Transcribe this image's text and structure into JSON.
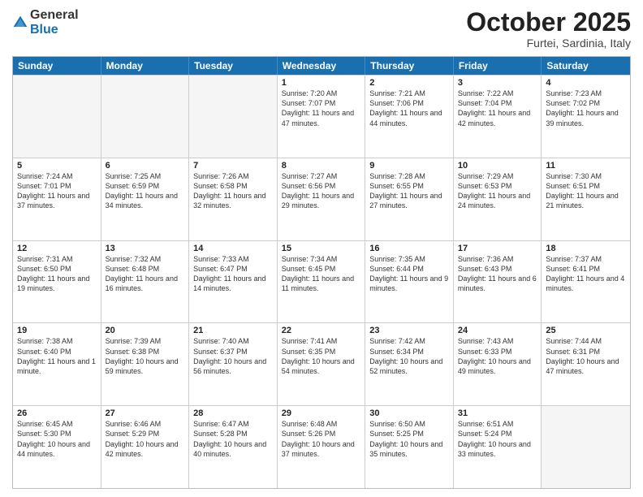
{
  "header": {
    "logo_general": "General",
    "logo_blue": "Blue",
    "month": "October 2025",
    "location": "Furtei, Sardinia, Italy"
  },
  "days_of_week": [
    "Sunday",
    "Monday",
    "Tuesday",
    "Wednesday",
    "Thursday",
    "Friday",
    "Saturday"
  ],
  "rows": [
    [
      {
        "day": "",
        "info": "",
        "empty": true
      },
      {
        "day": "",
        "info": "",
        "empty": true
      },
      {
        "day": "",
        "info": "",
        "empty": true
      },
      {
        "day": "1",
        "info": "Sunrise: 7:20 AM\nSunset: 7:07 PM\nDaylight: 11 hours and 47 minutes."
      },
      {
        "day": "2",
        "info": "Sunrise: 7:21 AM\nSunset: 7:06 PM\nDaylight: 11 hours and 44 minutes."
      },
      {
        "day": "3",
        "info": "Sunrise: 7:22 AM\nSunset: 7:04 PM\nDaylight: 11 hours and 42 minutes."
      },
      {
        "day": "4",
        "info": "Sunrise: 7:23 AM\nSunset: 7:02 PM\nDaylight: 11 hours and 39 minutes."
      }
    ],
    [
      {
        "day": "5",
        "info": "Sunrise: 7:24 AM\nSunset: 7:01 PM\nDaylight: 11 hours and 37 minutes."
      },
      {
        "day": "6",
        "info": "Sunrise: 7:25 AM\nSunset: 6:59 PM\nDaylight: 11 hours and 34 minutes."
      },
      {
        "day": "7",
        "info": "Sunrise: 7:26 AM\nSunset: 6:58 PM\nDaylight: 11 hours and 32 minutes."
      },
      {
        "day": "8",
        "info": "Sunrise: 7:27 AM\nSunset: 6:56 PM\nDaylight: 11 hours and 29 minutes."
      },
      {
        "day": "9",
        "info": "Sunrise: 7:28 AM\nSunset: 6:55 PM\nDaylight: 11 hours and 27 minutes."
      },
      {
        "day": "10",
        "info": "Sunrise: 7:29 AM\nSunset: 6:53 PM\nDaylight: 11 hours and 24 minutes."
      },
      {
        "day": "11",
        "info": "Sunrise: 7:30 AM\nSunset: 6:51 PM\nDaylight: 11 hours and 21 minutes."
      }
    ],
    [
      {
        "day": "12",
        "info": "Sunrise: 7:31 AM\nSunset: 6:50 PM\nDaylight: 11 hours and 19 minutes."
      },
      {
        "day": "13",
        "info": "Sunrise: 7:32 AM\nSunset: 6:48 PM\nDaylight: 11 hours and 16 minutes."
      },
      {
        "day": "14",
        "info": "Sunrise: 7:33 AM\nSunset: 6:47 PM\nDaylight: 11 hours and 14 minutes."
      },
      {
        "day": "15",
        "info": "Sunrise: 7:34 AM\nSunset: 6:45 PM\nDaylight: 11 hours and 11 minutes."
      },
      {
        "day": "16",
        "info": "Sunrise: 7:35 AM\nSunset: 6:44 PM\nDaylight: 11 hours and 9 minutes."
      },
      {
        "day": "17",
        "info": "Sunrise: 7:36 AM\nSunset: 6:43 PM\nDaylight: 11 hours and 6 minutes."
      },
      {
        "day": "18",
        "info": "Sunrise: 7:37 AM\nSunset: 6:41 PM\nDaylight: 11 hours and 4 minutes."
      }
    ],
    [
      {
        "day": "19",
        "info": "Sunrise: 7:38 AM\nSunset: 6:40 PM\nDaylight: 11 hours and 1 minute."
      },
      {
        "day": "20",
        "info": "Sunrise: 7:39 AM\nSunset: 6:38 PM\nDaylight: 10 hours and 59 minutes."
      },
      {
        "day": "21",
        "info": "Sunrise: 7:40 AM\nSunset: 6:37 PM\nDaylight: 10 hours and 56 minutes."
      },
      {
        "day": "22",
        "info": "Sunrise: 7:41 AM\nSunset: 6:35 PM\nDaylight: 10 hours and 54 minutes."
      },
      {
        "day": "23",
        "info": "Sunrise: 7:42 AM\nSunset: 6:34 PM\nDaylight: 10 hours and 52 minutes."
      },
      {
        "day": "24",
        "info": "Sunrise: 7:43 AM\nSunset: 6:33 PM\nDaylight: 10 hours and 49 minutes."
      },
      {
        "day": "25",
        "info": "Sunrise: 7:44 AM\nSunset: 6:31 PM\nDaylight: 10 hours and 47 minutes."
      }
    ],
    [
      {
        "day": "26",
        "info": "Sunrise: 6:45 AM\nSunset: 5:30 PM\nDaylight: 10 hours and 44 minutes."
      },
      {
        "day": "27",
        "info": "Sunrise: 6:46 AM\nSunset: 5:29 PM\nDaylight: 10 hours and 42 minutes."
      },
      {
        "day": "28",
        "info": "Sunrise: 6:47 AM\nSunset: 5:28 PM\nDaylight: 10 hours and 40 minutes."
      },
      {
        "day": "29",
        "info": "Sunrise: 6:48 AM\nSunset: 5:26 PM\nDaylight: 10 hours and 37 minutes."
      },
      {
        "day": "30",
        "info": "Sunrise: 6:50 AM\nSunset: 5:25 PM\nDaylight: 10 hours and 35 minutes."
      },
      {
        "day": "31",
        "info": "Sunrise: 6:51 AM\nSunset: 5:24 PM\nDaylight: 10 hours and 33 minutes."
      },
      {
        "day": "",
        "info": "",
        "empty": true
      }
    ]
  ]
}
